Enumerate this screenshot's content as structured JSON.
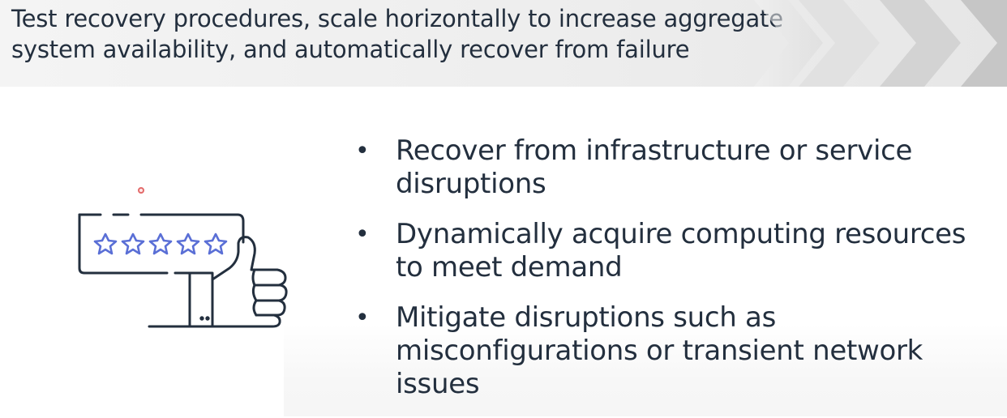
{
  "banner": {
    "text": "Test recovery procedures, scale horizontally to increase aggregate system availability, and automatically recover from failure"
  },
  "bullets": [
    {
      "text": "Recover from infrastructure or service disruptions"
    },
    {
      "text": "Dynamically acquire computing resources to meet demand"
    },
    {
      "text": "Mitigate disruptions such as misconfigurations or transient network issues"
    }
  ],
  "bullet_symbol": "•",
  "colors": {
    "text": "#232f3e",
    "star": "#5a6fd6",
    "banner": "#efefef",
    "chevron": "#c9c9c9"
  },
  "illustration": {
    "icon": "thumbs-up-rating-icon",
    "stars": 5
  }
}
